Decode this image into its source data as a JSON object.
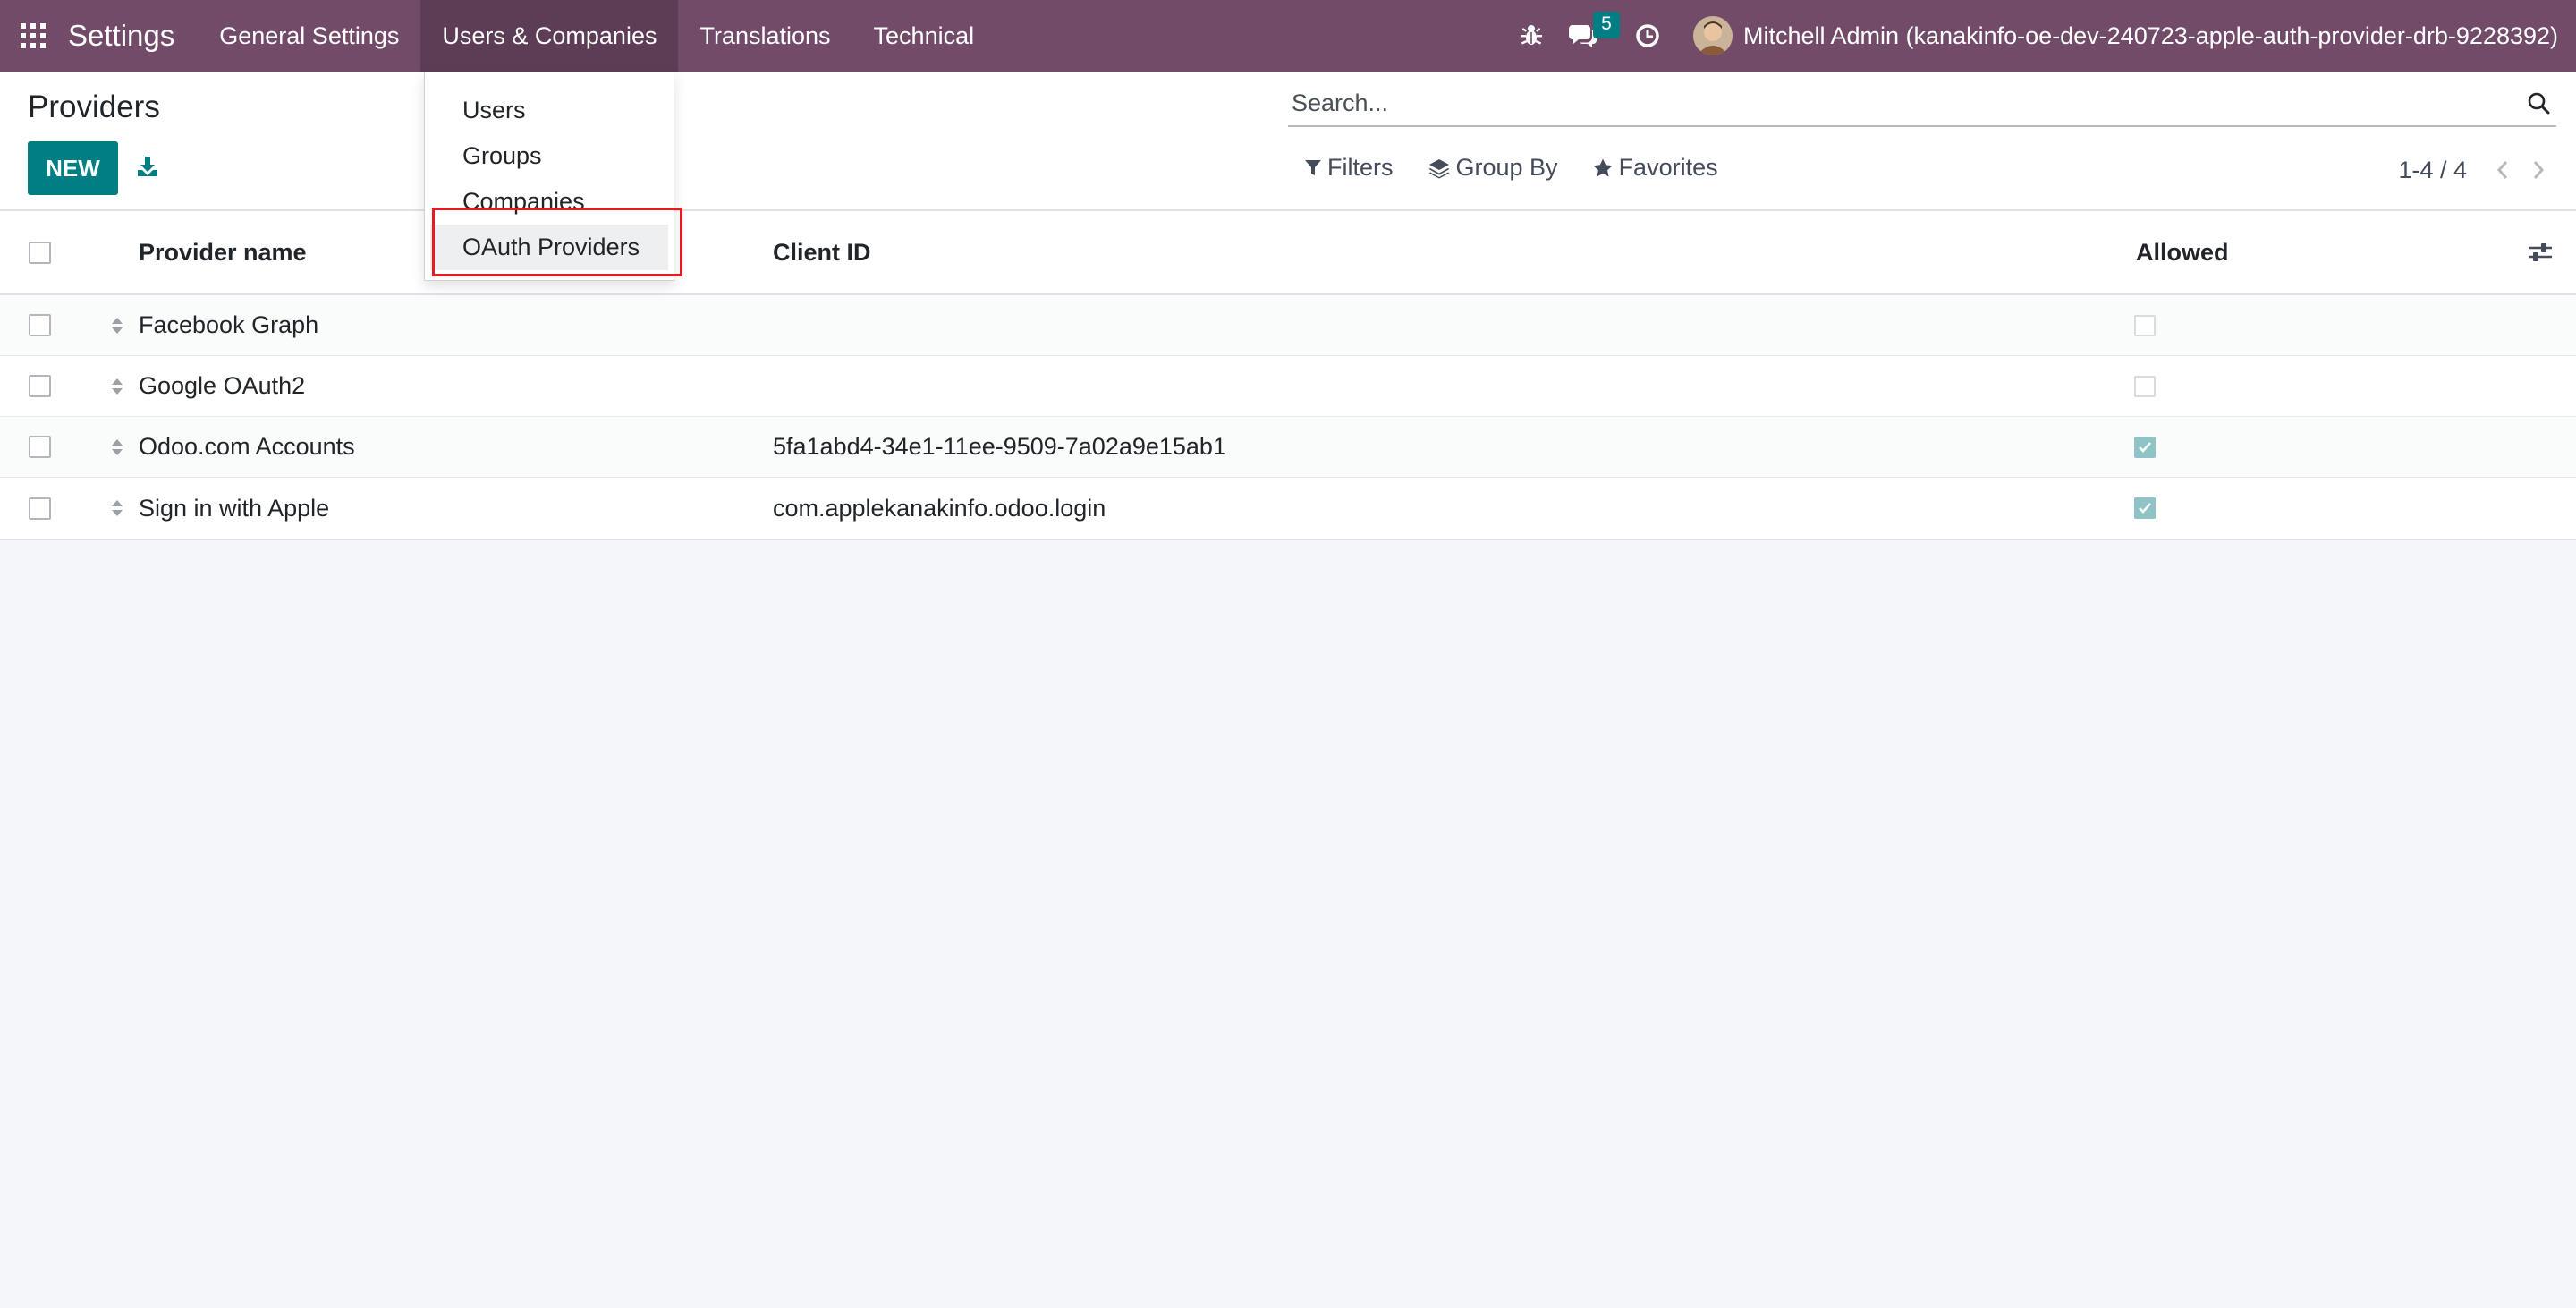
{
  "navbar": {
    "apps_icon": "grid-icon",
    "brand": "Settings",
    "menus": [
      "General Settings",
      "Users & Companies",
      "Translations",
      "Technical"
    ],
    "active_menu": "Users & Companies",
    "debug_icon": "bug-icon",
    "messages_icon": "chat-icon",
    "messages_count": "5",
    "activity_icon": "clock-icon",
    "user_name": "Mitchell Admin (kanakinfo-oe-dev-240723-apple-auth-provider-drb-9228392)",
    "bar_color": "#714b67"
  },
  "dropdown": {
    "items": [
      "Users",
      "Groups",
      "Companies",
      "OAuth Providers"
    ],
    "highlighted": "OAuth Providers",
    "highlight_color": "#e31b23"
  },
  "control_panel": {
    "title": "Providers",
    "new_label": "NEW",
    "export_icon": "download-icon",
    "search_placeholder": "Search...",
    "filters_label": "Filters",
    "group_by_label": "Group By",
    "favorites_label": "Favorites",
    "pager": "1-4 / 4",
    "primary_color": "#017e84"
  },
  "table": {
    "columns": {
      "provider_name": "Provider name",
      "client_id": "Client ID",
      "allowed": "Allowed"
    },
    "settings_icon": "sliders-icon",
    "rows": [
      {
        "name": "Facebook Graph",
        "client_id": "",
        "allowed": false
      },
      {
        "name": "Google OAuth2",
        "client_id": "",
        "allowed": false
      },
      {
        "name": "Odoo.com Accounts",
        "client_id": "5fa1abd4-34e1-11ee-9509-7a02a9e15ab1",
        "allowed": true
      },
      {
        "name": "Sign in with Apple",
        "client_id": "com.applekanakinfo.odoo.login",
        "allowed": true
      }
    ]
  }
}
